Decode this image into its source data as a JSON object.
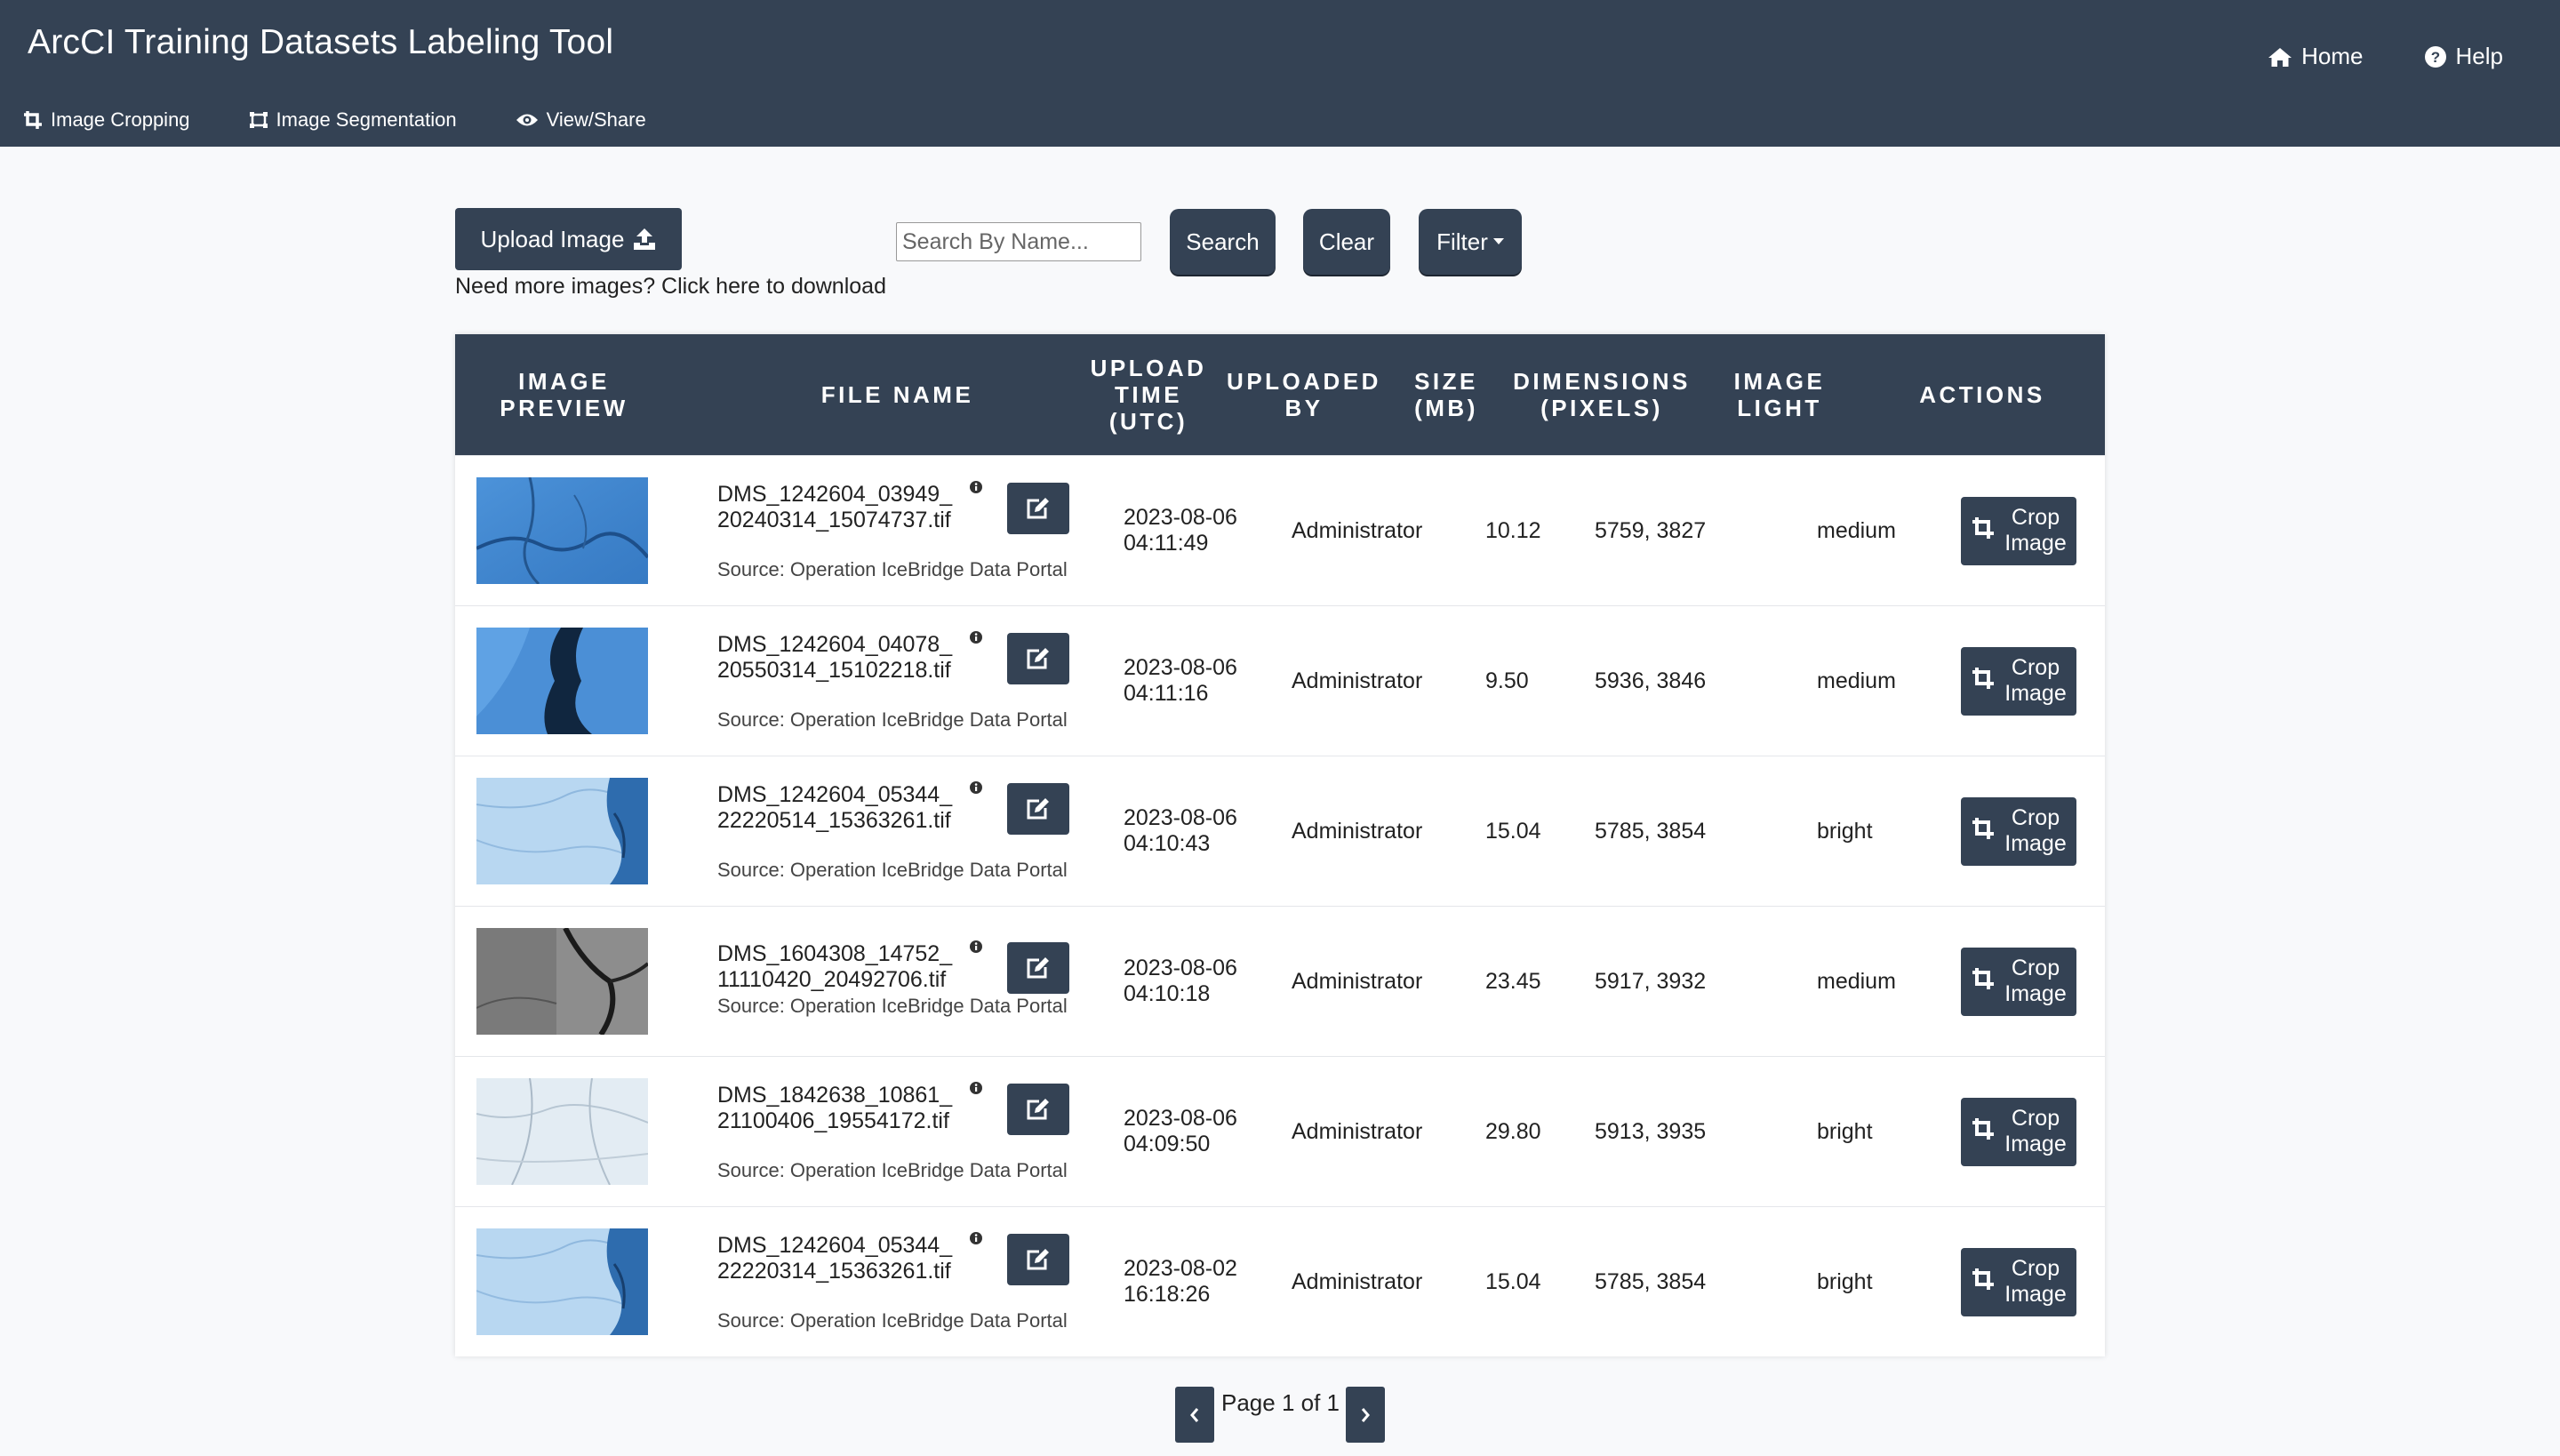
{
  "app": {
    "title": "ArcCI Training Datasets Labeling Tool"
  },
  "nav": {
    "right": [
      {
        "label": "Home",
        "icon": "home-icon"
      },
      {
        "label": "Help",
        "icon": "help-icon"
      }
    ],
    "sub": [
      {
        "label": "Image Cropping",
        "icon": "crop-icon"
      },
      {
        "label": "Image Segmentation",
        "icon": "segmentation-icon"
      },
      {
        "label": "View/Share",
        "icon": "eye-icon"
      }
    ]
  },
  "toolbar": {
    "upload_label": "Upload Image",
    "download_link": "Need more images? Click here to download",
    "search_placeholder": "Search By Name...",
    "search_label": "Search",
    "clear_label": "Clear",
    "filter_label": "Filter"
  },
  "table": {
    "headers": [
      "IMAGE\nPREVIEW",
      "FILE NAME",
      "UPLOAD\nTIME\n(UTC)",
      "UPLOADED\nBY",
      "SIZE\n(MB)",
      "DIMENSIONS\n(PIXELS)",
      "IMAGE\nLIGHT",
      "ACTIONS"
    ],
    "rows": [
      {
        "name_line1": "DMS_1242604_03949_",
        "name_line2": "20240314_15074737.tif",
        "source": "Source: Operation IceBridge Data Portal",
        "date": "2023-08-06",
        "time": "04:11:49",
        "uploaded_by": "Administrator",
        "size": "10.12",
        "dimensions": "5759, 3827",
        "light": "medium",
        "action_line1": "Crop",
        "action_line2": "Image",
        "thumb": "blue-cracked"
      },
      {
        "name_line1": "DMS_1242604_04078_",
        "name_line2": "20550314_15102218.tif",
        "source": "Source: Operation IceBridge Data Portal",
        "date": "2023-08-06",
        "time": "04:11:16",
        "uploaded_by": "Administrator",
        "size": "9.50",
        "dimensions": "5936, 3846",
        "light": "medium",
        "action_line1": "Crop",
        "action_line2": "Image",
        "thumb": "blue-dark-lead"
      },
      {
        "name_line1": "DMS_1242604_05344_",
        "name_line2": "22220514_15363261.tif",
        "source": "Source: Operation IceBridge Data Portal",
        "date": "2023-08-06",
        "time": "04:10:43",
        "uploaded_by": "Administrator",
        "size": "15.04",
        "dimensions": "5785, 3854",
        "light": "bright",
        "action_line1": "Crop",
        "action_line2": "Image",
        "thumb": "light-blue-ice"
      },
      {
        "name_line1": "DMS_1604308_14752_",
        "name_line2": "11110420_20492706.tif",
        "source": "Source: Operation IceBridge Data Portal",
        "date": "2023-08-06",
        "time": "04:10:18",
        "uploaded_by": "Administrator",
        "size": "23.45",
        "dimensions": "5917, 3932",
        "light": "medium",
        "action_line1": "Crop",
        "action_line2": "Image",
        "thumb": "gray-cracks"
      },
      {
        "name_line1": "DMS_1842638_10861_",
        "name_line2": "21100406_19554172.tif",
        "source": "Source: Operation IceBridge Data Portal",
        "date": "2023-08-06",
        "time": "04:09:50",
        "uploaded_by": "Administrator",
        "size": "29.80",
        "dimensions": "5913, 3935",
        "light": "bright",
        "action_line1": "Crop",
        "action_line2": "Image",
        "thumb": "white-ice"
      },
      {
        "name_line1": "DMS_1242604_05344_",
        "name_line2": "22220314_15363261.tif",
        "source": "Source: Operation IceBridge Data Portal",
        "date": "2023-08-02",
        "time": "16:18:26",
        "uploaded_by": "Administrator",
        "size": "15.04",
        "dimensions": "5785, 3854",
        "light": "bright",
        "action_line1": "Crop",
        "action_line2": "Image",
        "thumb": "light-blue-ice"
      }
    ]
  },
  "pagination": {
    "text": "Page 1 of 1"
  },
  "colors": {
    "navbar": "#344254",
    "button": "#344254",
    "background": "#f8f9fb"
  }
}
